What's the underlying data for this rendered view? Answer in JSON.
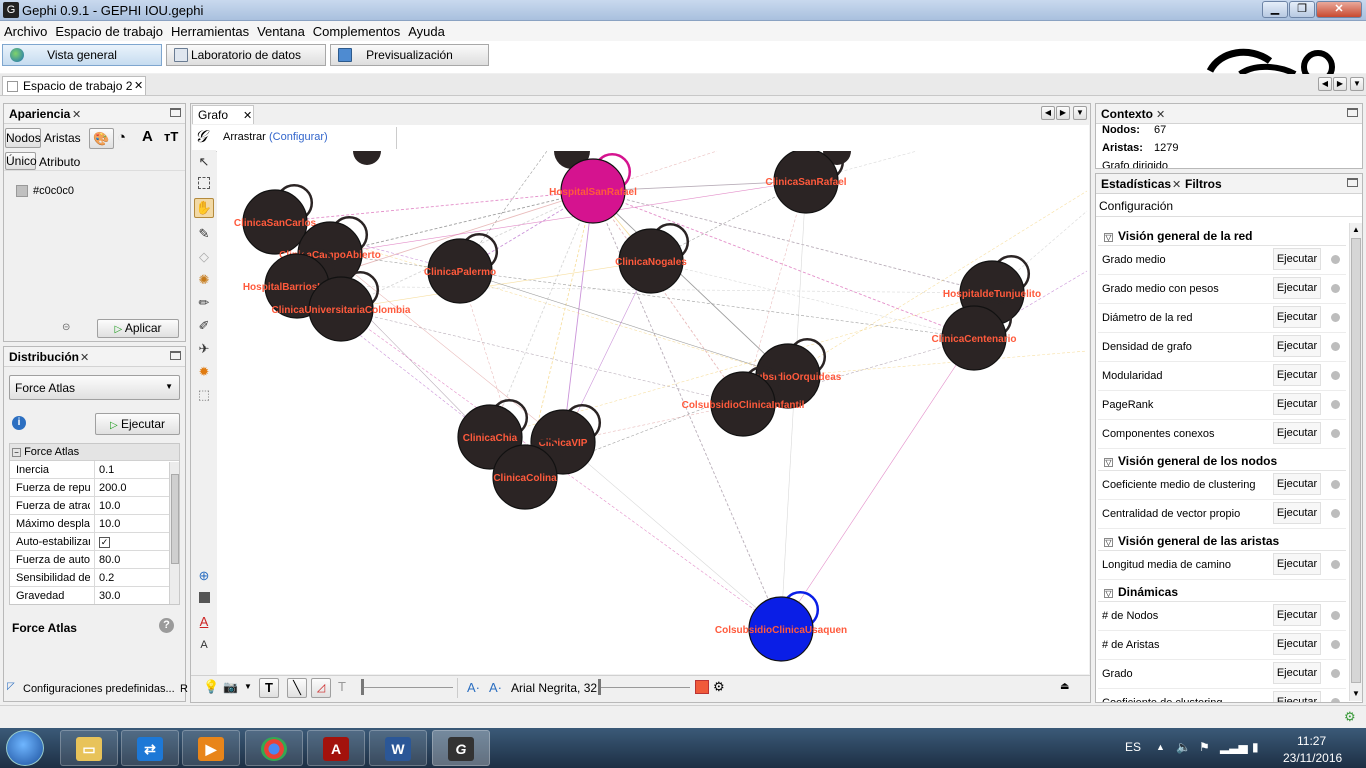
{
  "window": {
    "title": "Gephi 0.9.1 - GEPHI IOU.gephi"
  },
  "menu": [
    "Archivo",
    "Espacio de trabajo",
    "Herramientas",
    "Ventana",
    "Complementos",
    "Ayuda"
  ],
  "modes": [
    {
      "label": "Vista general",
      "active": true
    },
    {
      "label": "Laboratorio de datos",
      "active": false
    },
    {
      "label": "Previsualización",
      "active": false
    }
  ],
  "workspace_tab": "Espacio de trabajo 2",
  "appearance": {
    "title": "Apariencia",
    "tabs": [
      "Nodos",
      "Aristas"
    ],
    "subtabs": [
      "Único",
      "Atributo"
    ],
    "color_value": "#c0c0c0",
    "apply_label": "Aplicar"
  },
  "layout": {
    "title": "Distribución",
    "algorithm": "Force Atlas",
    "run_label": "Ejecutar",
    "group_label": "Force Atlas",
    "properties": [
      {
        "key": "Inercia",
        "value": "0.1"
      },
      {
        "key": "Fuerza de repu",
        "value": "200.0"
      },
      {
        "key": "Fuerza de atrac",
        "value": "10.0"
      },
      {
        "key": "Máximo despla:",
        "value": "10.0"
      },
      {
        "key": "Auto-estabilizar",
        "value": ""
      },
      {
        "key": "Fuerza de auto",
        "value": "80.0"
      },
      {
        "key": "Sensibilidad de",
        "value": "0.2"
      },
      {
        "key": "Gravedad",
        "value": "30.0"
      }
    ],
    "footer_name": "Force Atlas",
    "presets_label": "Configuraciones predefinidas...",
    "presets_trailing": "R"
  },
  "graph": {
    "tab": "Grafo",
    "drag_label": "Arrastrar",
    "configure_label": "(Configurar)",
    "font_label": "Arial Negrita, 32",
    "nodes": [
      {
        "label": "HospitalSanRafael",
        "color": "#d5138f"
      },
      {
        "label": "ClinicaSanRafael",
        "color": "#2b2424"
      },
      {
        "label": "ClinicaSanCarlos",
        "color": "#2b2424"
      },
      {
        "label": "ClinicaCampoAbierto",
        "color": "#2b2424"
      },
      {
        "label": "HospitalBarriosUnidos",
        "color": "#2b2424"
      },
      {
        "label": "ClinicaUniversitariaColombia",
        "color": "#2b2424"
      },
      {
        "label": "ClinicaPalermo",
        "color": "#2b2424"
      },
      {
        "label": "ClinicaNogales",
        "color": "#2b2424"
      },
      {
        "label": "HospitaldeTunjuelito",
        "color": "#2b2424"
      },
      {
        "label": "ClinicaCentenario",
        "color": "#2b2424"
      },
      {
        "label": "ColsubsidioOrquideas",
        "color": "#2b2424"
      },
      {
        "label": "ColsubsidioClinicaInfantil",
        "color": "#2b2424"
      },
      {
        "label": "ClinicaChia",
        "color": "#2b2424"
      },
      {
        "label": "ClinicaVIP",
        "color": "#2b2424"
      },
      {
        "label": "ClinicaColina",
        "color": "#2b2424"
      },
      {
        "label": "ColsubsidioClinicaUsaquen",
        "color": "#0a1ee6"
      }
    ]
  },
  "context": {
    "title": "Contexto",
    "nodes_label": "Nodos:",
    "nodes_value": "67",
    "edges_label": "Aristas:",
    "edges_value": "1279",
    "graph_type": "Grafo dirigido"
  },
  "statistics": {
    "tabs": [
      "Estadísticas",
      "Filtros"
    ],
    "config_label": "Configuración",
    "run_label": "Ejecutar",
    "sections": [
      {
        "title": "Visión general de la red",
        "items": [
          "Grado medio",
          "Grado medio con pesos",
          "Diámetro de la red",
          "Densidad de grafo",
          "Modularidad",
          "PageRank",
          "Componentes conexos"
        ]
      },
      {
        "title": "Visión general de los nodos",
        "items": [
          "Coeficiente medio de clustering",
          "Centralidad de vector propio"
        ]
      },
      {
        "title": "Visión general de las aristas",
        "items": [
          "Longitud media de camino"
        ]
      },
      {
        "title": "Dinámicas",
        "items": [
          "# de Nodos",
          "# de Aristas",
          "Grado",
          "Coeficiente de clustering"
        ]
      }
    ]
  },
  "taskbar": {
    "lang": "ES",
    "time": "11:27",
    "date": "23/11/2016"
  },
  "colors": {
    "node_label": "#ff5a3c",
    "accent": "#3366cc"
  }
}
